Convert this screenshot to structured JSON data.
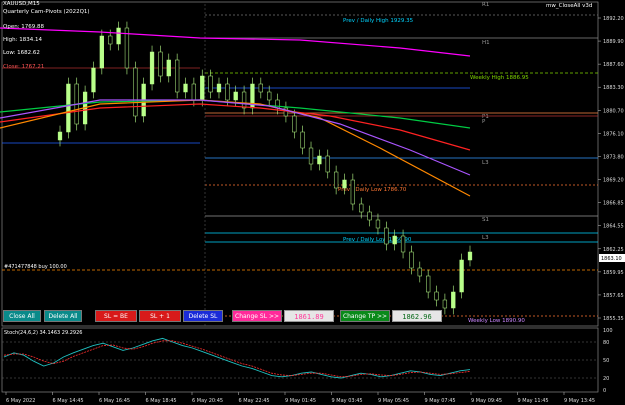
{
  "window": {
    "symbol": "XAUUSD,M15",
    "expert": "mw_CloseAll v3d"
  },
  "info_panel": {
    "title": "Quarterly Cam-Pivots (2022Q1)",
    "open": "Open: 1769.88",
    "high": "High: 1834.14",
    "low": "Low: 1682.62",
    "close": "Close: 1767.21"
  },
  "level_labels": {
    "r1": "R1",
    "prev_daily_high": "Prev / Daily High 1929.35",
    "h1": "H1",
    "weekly_high": "Weekly High 1886.95",
    "p1": "P1",
    "p2": "P",
    "l3": "L3",
    "prev_daily_low": "Prev / Daily Low 1786.70",
    "s1": "S1",
    "l3b": "L3",
    "prev_daily_low2": "Prev / Daily Low 1850.90",
    "weekly_low": "Weekly Low 1890.90",
    "order": "#471477848 buy 100.00"
  },
  "price_axis": {
    "ticks": [
      "1892.20",
      "1889.90",
      "1887.60",
      "1883.30",
      "1880.70",
      "1876.10",
      "1873.80",
      "1869.20",
      "1866.85",
      "1864.55",
      "1862.25",
      "1859.95",
      "1857.65",
      "1855.35"
    ],
    "current_price": "1863.10"
  },
  "time_axis": {
    "labels": [
      "6 May 2022",
      "6 May 14:45",
      "6 May 16:45",
      "6 May 18:45",
      "6 May 20:45",
      "6 May 22:45",
      "9 May 01:45",
      "9 May 03:45",
      "9 May 05:45",
      "9 May 07:45",
      "9 May 09:45",
      "9 May 11:45",
      "9 May 13:45"
    ]
  },
  "toolbar": {
    "close_all": "Close All",
    "delete_all": "Delete All",
    "sl_be": "SL = BE",
    "sl_plus": "SL + 1",
    "delete_sl": "Delete SL",
    "change_sl": "Change SL >>",
    "sl_value": "1861.89",
    "change_tp": "Change TP >>",
    "tp_value": "1862.96"
  },
  "stoch": {
    "label": "Stoch(24,6,2) 34.1463 29.2926",
    "ticks": [
      "100",
      "80",
      "50",
      "20",
      "0"
    ],
    "main_line": [
      55,
      62,
      58,
      48,
      40,
      45,
      55,
      62,
      68,
      74,
      78,
      72,
      66,
      70,
      76,
      82,
      86,
      80,
      74,
      70,
      64,
      58,
      52,
      46,
      40,
      36,
      30,
      24,
      22,
      24,
      28,
      30,
      26,
      22,
      20,
      24,
      28,
      26,
      22,
      24,
      28,
      32,
      30,
      26,
      24,
      28,
      32,
      34
    ],
    "signal_line": [
      58,
      60,
      60,
      55,
      48,
      44,
      48,
      56,
      62,
      68,
      74,
      75,
      70,
      68,
      72,
      78,
      82,
      82,
      78,
      73,
      68,
      62,
      56,
      50,
      44,
      40,
      34,
      28,
      25,
      24,
      26,
      28,
      28,
      25,
      22,
      23,
      26,
      27,
      25,
      24,
      26,
      29,
      30,
      28,
      26,
      27,
      29,
      31
    ]
  },
  "chart_data": {
    "type": "candlestick",
    "symbol": "XAUUSD",
    "timeframe": "M15",
    "ylim": [
      1854.5,
      1893.5
    ],
    "candles_close": [
      1878,
      1884,
      1879,
      1883,
      1886,
      1890,
      1889,
      1891,
      1886,
      1880,
      1884,
      1888,
      1885,
      1887,
      1883,
      1884,
      1882,
      1885,
      1883,
      1884,
      1882,
      1883,
      1881,
      1884,
      1883,
      1882,
      1881,
      1880,
      1878,
      1876,
      1874,
      1875,
      1873,
      1871,
      1872,
      1869,
      1868,
      1867,
      1866,
      1864,
      1865,
      1863,
      1861,
      1860,
      1858,
      1857,
      1856,
      1858,
      1862,
      1863
    ],
    "series": [
      {
        "name": "",
        "color": "#ff00ff"
      },
      {
        "name": "",
        "color": "#00cc44"
      },
      {
        "name": "",
        "color": "#ff2222"
      },
      {
        "name": "",
        "color": "#ff8800"
      },
      {
        "name": "",
        "color": "#aa55ff"
      }
    ]
  },
  "colors": {
    "candle": "#b9ff8a",
    "prev_high_line": "#00e5ff",
    "weekly_high_line": "#7fd400",
    "order_line": "#ff8a00",
    "blue_line": "#2060ff"
  }
}
